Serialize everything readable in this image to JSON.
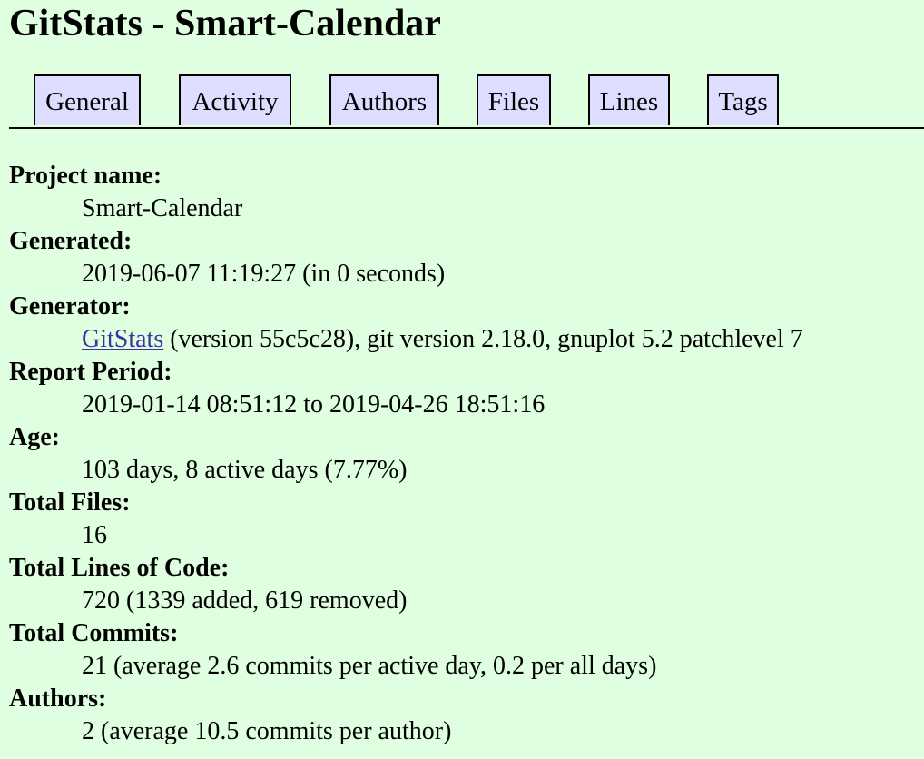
{
  "page": {
    "title": "GitStats - Smart-Calendar"
  },
  "nav": {
    "tabs": [
      {
        "label": "General"
      },
      {
        "label": "Activity"
      },
      {
        "label": "Authors"
      },
      {
        "label": "Files"
      },
      {
        "label": "Lines"
      },
      {
        "label": "Tags"
      }
    ]
  },
  "general": {
    "project_name": {
      "label": "Project name:",
      "value": "Smart-Calendar"
    },
    "generated": {
      "label": "Generated:",
      "value": "2019-06-07 11:19:27 (in 0 seconds)"
    },
    "generator": {
      "label": "Generator:",
      "link_text": "GitStats",
      "value_rest": " (version 55c5c28), git version 2.18.0, gnuplot 5.2 patchlevel 7"
    },
    "report_period": {
      "label": "Report Period:",
      "value": "2019-01-14 08:51:12 to 2019-04-26 18:51:16"
    },
    "age": {
      "label": "Age:",
      "value": "103 days, 8 active days (7.77%)"
    },
    "total_files": {
      "label": "Total Files:",
      "value": "16"
    },
    "total_lines": {
      "label": "Total Lines of Code:",
      "value": "720 (1339 added, 619 removed)"
    },
    "total_commits": {
      "label": "Total Commits:",
      "value": "21 (average 2.6 commits per active day, 0.2 per all days)"
    },
    "authors": {
      "label": "Authors:",
      "value": "2 (average 10.5 commits per author)"
    }
  },
  "colors": {
    "background": "#e0ffe0",
    "tab_background": "#ddddff",
    "link": "#4030a0"
  }
}
